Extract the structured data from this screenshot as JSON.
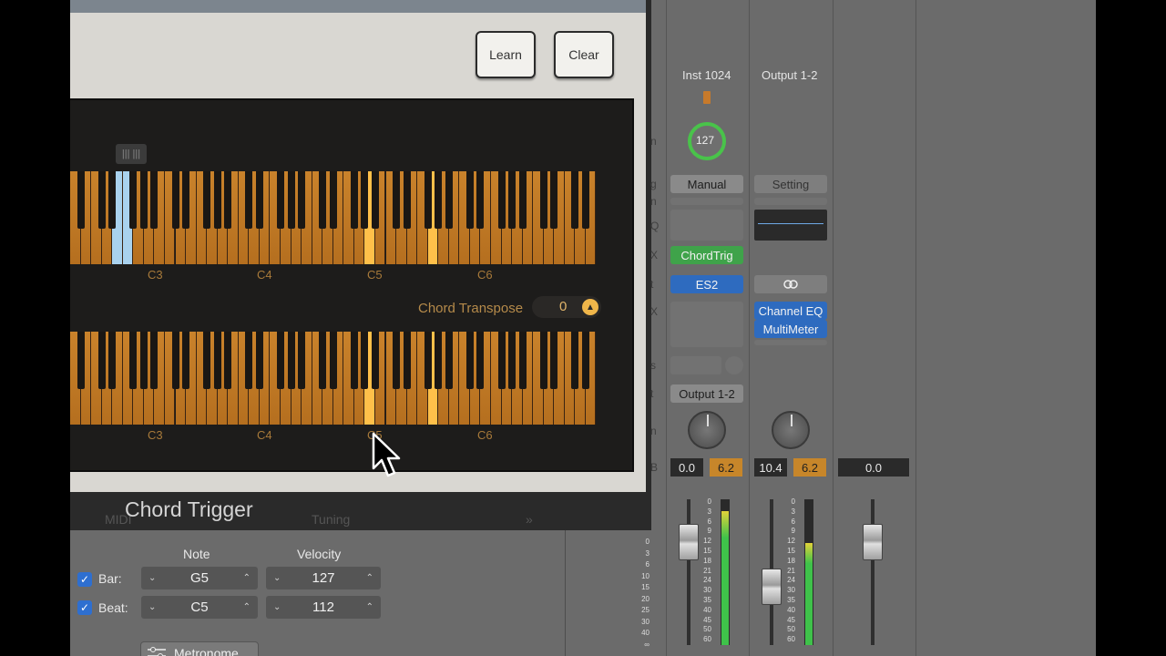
{
  "plugin": {
    "title": "Chord Trigger",
    "buttons": {
      "learn": "Learn",
      "clear": "Clear"
    },
    "learn_hint": "||| |||",
    "upper_keyboard_labels": [
      "C3",
      "C4",
      "C5",
      "C6"
    ],
    "lower_keyboard_labels": [
      "C3",
      "C4",
      "C5",
      "C6"
    ],
    "chord_transpose": {
      "label": "Chord Transpose",
      "value": "0"
    },
    "ghost_tabs": [
      "MIDI",
      "Tuning",
      "»"
    ]
  },
  "inspector": {
    "headers": {
      "note": "Note",
      "velocity": "Velocity"
    },
    "rows": [
      {
        "label": "Bar:",
        "checked": true,
        "note": "G5",
        "velocity": "127"
      },
      {
        "label": "Beat:",
        "checked": true,
        "note": "C5",
        "velocity": "112"
      }
    ],
    "metronome_button": "Metronome"
  },
  "mixer": {
    "strips": [
      {
        "name": "Inst 1024",
        "knob_value": "127",
        "setting": "Manual",
        "midi_fx": "ChordTrig",
        "instrument": "ES2",
        "output": "Output 1-2",
        "volume": "0.0",
        "peak": "6.2"
      },
      {
        "name": "Output 1-2",
        "setting": "Setting",
        "link_icon": "link-icon",
        "inserts": [
          "Channel EQ",
          "MultiMeter"
        ],
        "volume": "10.4",
        "peak": "6.2"
      },
      {
        "volume": "0.0"
      }
    ],
    "scale_left": [
      "0",
      "3",
      "6",
      "10",
      "15",
      "20",
      "25",
      "30",
      "40",
      "∞"
    ],
    "meter_scale": [
      "0",
      "3",
      "6",
      "9",
      "12",
      "15",
      "18",
      "21",
      "24",
      "30",
      "35",
      "40",
      "45",
      "50",
      "60"
    ],
    "hidden_labels": [
      "n",
      "g",
      "n",
      "Q",
      "X",
      "t",
      "X",
      "s",
      "t",
      "n",
      "B"
    ]
  },
  "colors": {
    "accent_orange": "#c9822b",
    "highlight_yellow": "#ffc04a",
    "highlight_blue": "#a9d2ee",
    "insert_blue": "#2e6bbf",
    "midi_fx_green": "#3fa34a"
  }
}
